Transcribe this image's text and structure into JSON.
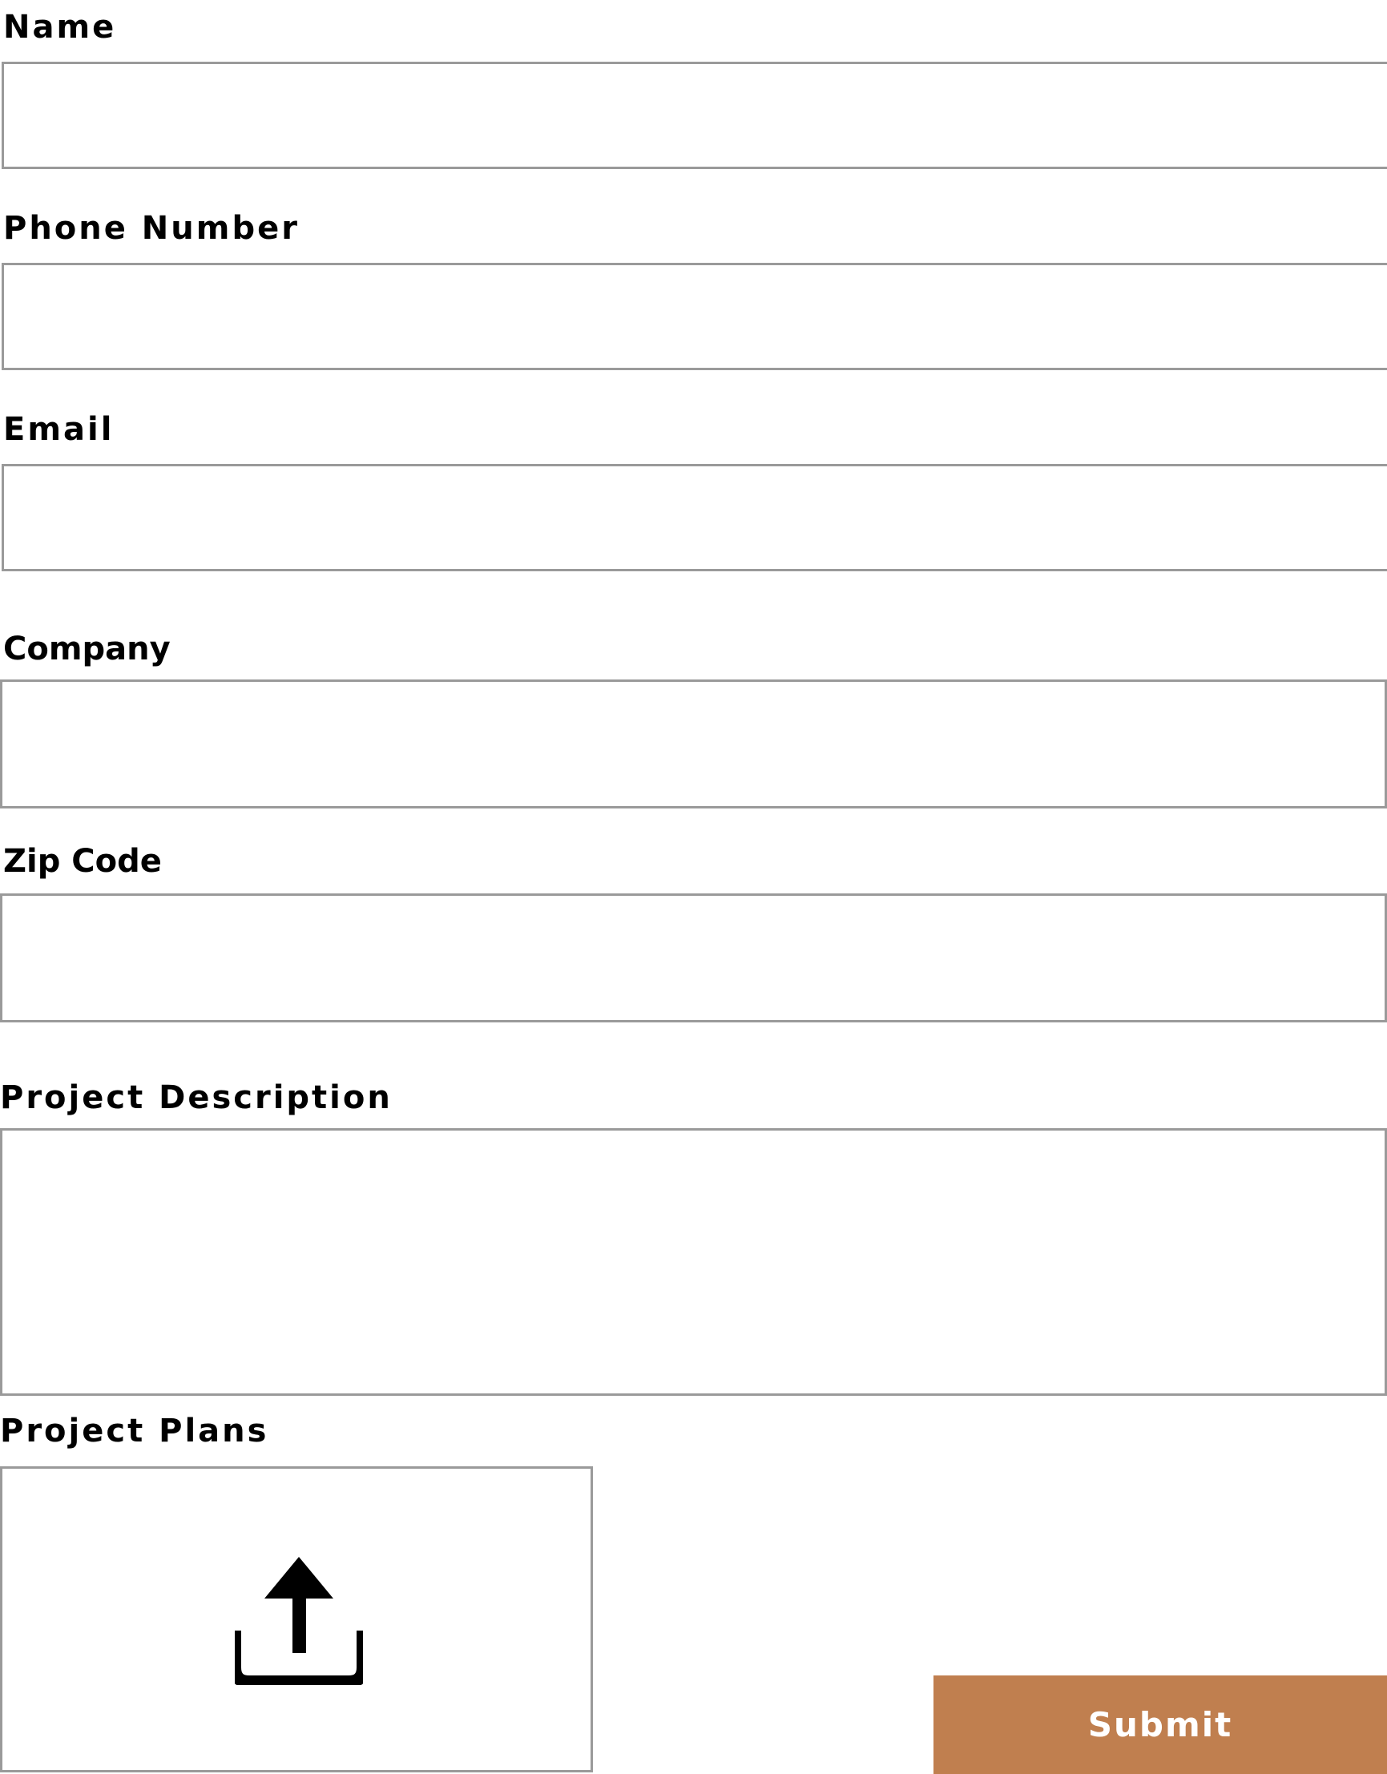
{
  "form": {
    "fields": {
      "name": {
        "label": "Name",
        "value": "",
        "placeholder": ""
      },
      "phone": {
        "label": "Phone Number",
        "value": "",
        "placeholder": ""
      },
      "email": {
        "label": "Email",
        "value": "",
        "placeholder": ""
      },
      "company": {
        "label": "Company",
        "value": "",
        "placeholder": ""
      },
      "zip": {
        "label": "Zip Code",
        "value": "",
        "placeholder": ""
      },
      "description": {
        "label": "Project Description",
        "value": "",
        "placeholder": ""
      },
      "plans": {
        "label": "Project Plans",
        "icon": "upload-icon"
      }
    },
    "submit_label": "Submit"
  },
  "colors": {
    "accent": "#c07f4f",
    "border": "#9a9a9a",
    "text": "#000000",
    "background": "#ffffff"
  }
}
